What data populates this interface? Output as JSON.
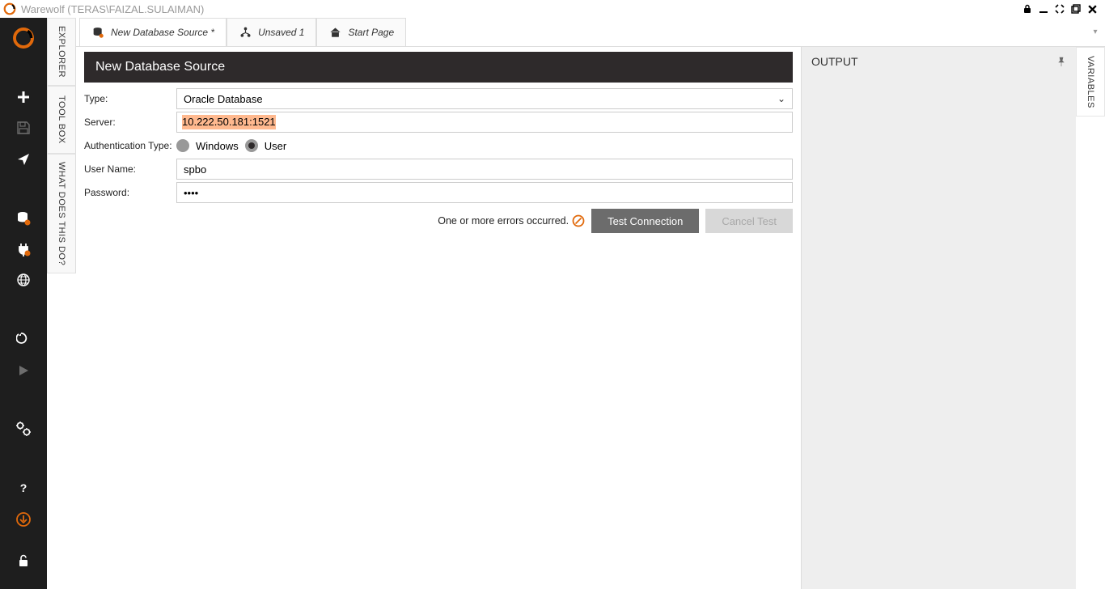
{
  "titlebar": {
    "title": "Warewolf (TERAS\\FAIZAL.SULAIMAN)"
  },
  "vtabs": [
    {
      "label": "EXPLORER"
    },
    {
      "label": "TOOL BOX"
    },
    {
      "label": "WHAT DOES THIS DO?"
    }
  ],
  "rvtabs": [
    {
      "label": "VARIABLES"
    }
  ],
  "tabs": [
    {
      "label": "New Database Source *",
      "active": true
    },
    {
      "label": "Unsaved 1",
      "active": false
    },
    {
      "label": "Start Page",
      "active": false
    }
  ],
  "page": {
    "header": "New Database Source",
    "type_label": "Type:",
    "type_value": "Oracle Database",
    "server_label": "Server:",
    "server_value": "10.222.50.181:1521",
    "auth_label": "Authentication Type:",
    "auth_windows": "Windows",
    "auth_user": "User",
    "username_label": "User Name:",
    "username_value": "spbo",
    "password_label": "Password:",
    "password_value": "••••",
    "error_message": "One or more errors occurred.",
    "test_btn": "Test Connection",
    "cancel_btn": "Cancel Test"
  },
  "output": {
    "title": "OUTPUT"
  }
}
